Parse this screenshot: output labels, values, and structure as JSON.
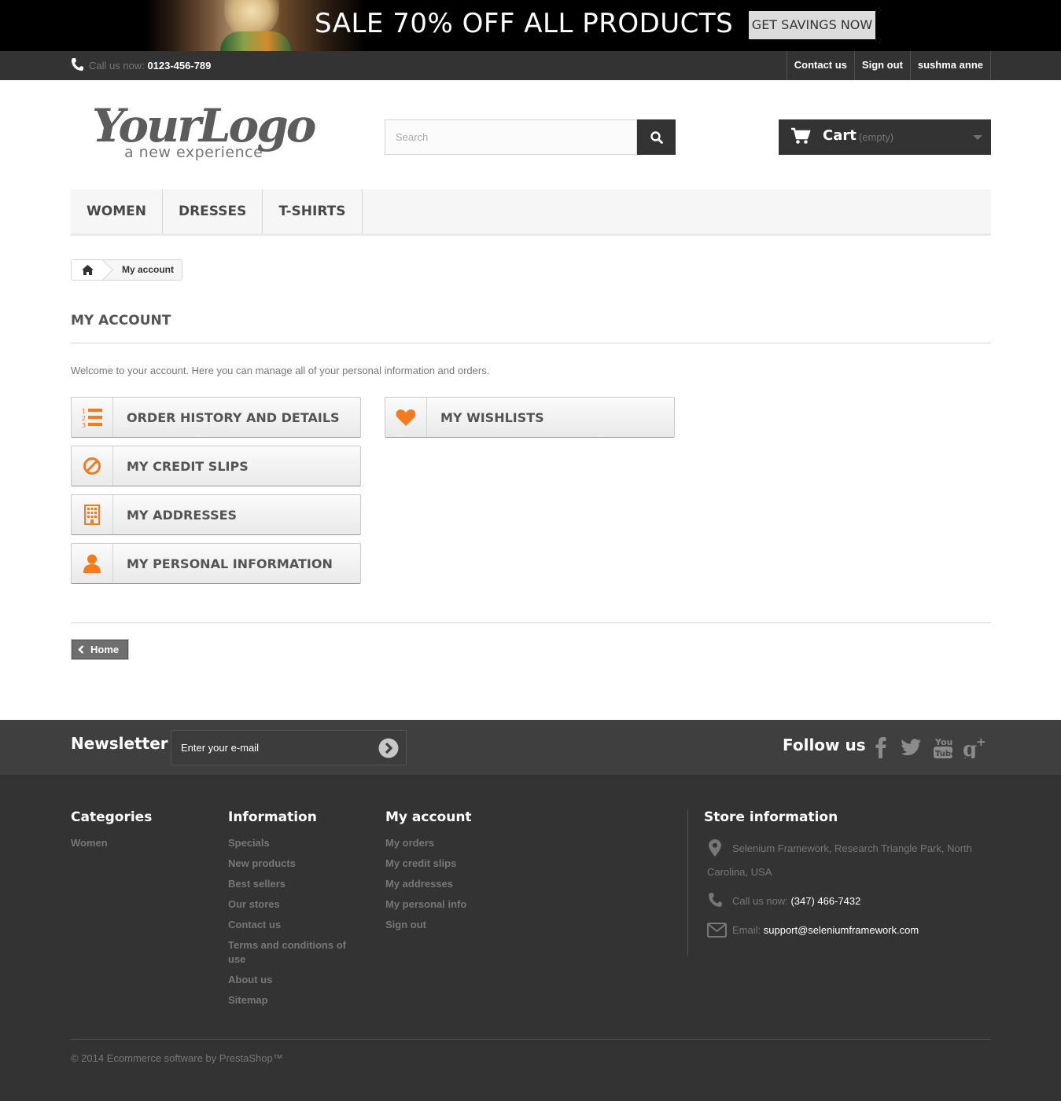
{
  "banner": {
    "headline": "SALE 70% OFF ALL PRODUCTS",
    "cta": "GET SAVINGS NOW"
  },
  "topbar": {
    "call_label": "Call us now:",
    "phone": "0123-456-789",
    "links": [
      "Contact us",
      "Sign out",
      "sushma anne"
    ]
  },
  "logo": {
    "name": "YourLogo",
    "tagline": "a new experience"
  },
  "search": {
    "placeholder": "Search"
  },
  "cart": {
    "label": "Cart",
    "status": "(empty)"
  },
  "menu": [
    "WOMEN",
    "DRESSES",
    "T-SHIRTS"
  ],
  "breadcrumb": {
    "current": "My account"
  },
  "page": {
    "title": "MY ACCOUNT",
    "welcome": "Welcome to your account. Here you can manage all of your personal information and orders.",
    "buttons": {
      "order_history": "ORDER HISTORY AND DETAILS",
      "credit_slips": "MY CREDIT SLIPS",
      "addresses": "MY ADDRESSES",
      "personal_info": "MY PERSONAL INFORMATION",
      "wishlists": "MY WISHLISTS"
    },
    "home_button": "Home"
  },
  "newsletter": {
    "title": "Newsletter",
    "placeholder": "Enter your e-mail",
    "follow_title": "Follow us"
  },
  "footer": {
    "categories": {
      "title": "Categories",
      "items": [
        "Women"
      ]
    },
    "information": {
      "title": "Information",
      "items": [
        "Specials",
        "New products",
        "Best sellers",
        "Our stores",
        "Contact us",
        "Terms and conditions of use",
        "About us",
        "Sitemap"
      ]
    },
    "my_account": {
      "title": "My account",
      "items": [
        "My orders",
        "My credit slips",
        "My addresses",
        "My personal info",
        "Sign out"
      ]
    },
    "store": {
      "title": "Store information",
      "address_line1": "Selenium Framework, Research Triangle Park, North",
      "address_line2": "Carolina, USA",
      "call_label": "Call us now:",
      "phone": "(347) 466-7432",
      "email_label": "Email:",
      "email": "support@seleniumframework.com"
    },
    "copyright": "© 2014 Ecommerce software by PrestaShop™"
  },
  "colors": {
    "accent": "#f47c20",
    "dark": "#333333",
    "bar": "#3f3f3f"
  }
}
